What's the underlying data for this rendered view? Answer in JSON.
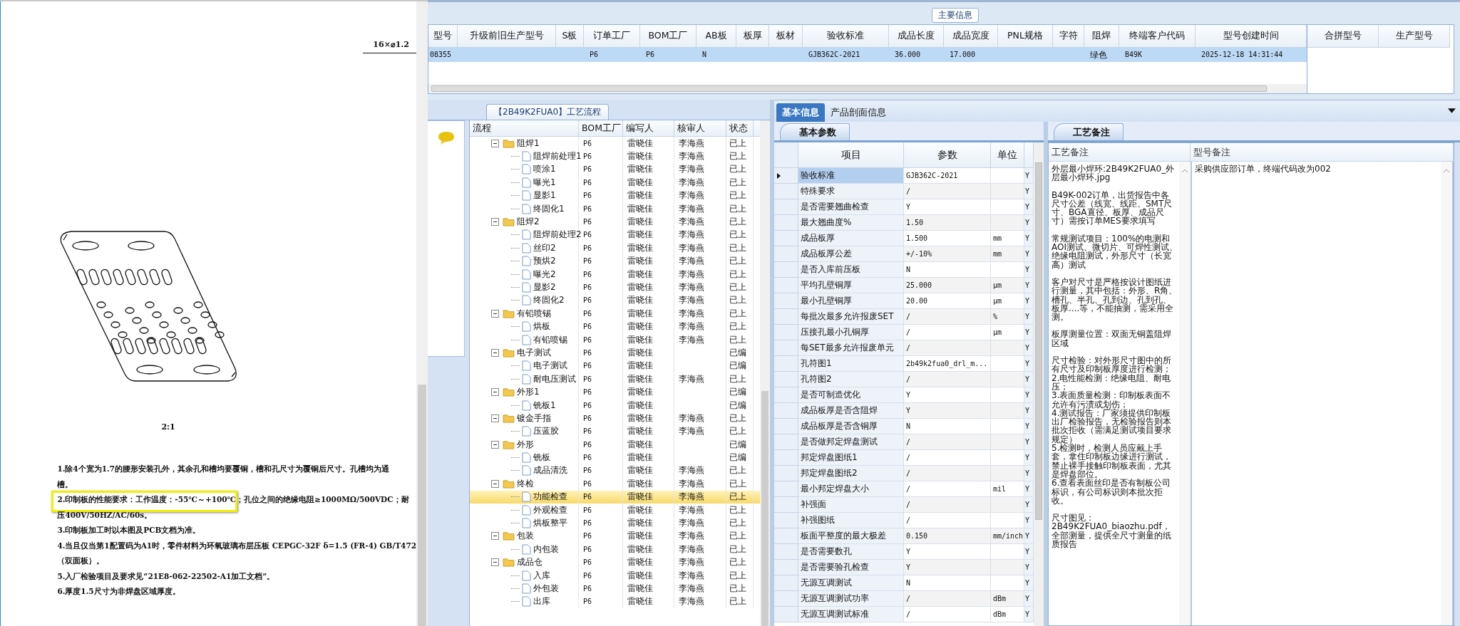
{
  "document": {
    "dimension": "16×⌀1.2",
    "scale": "2:1",
    "notes": [
      "1.除4个宽为1.7的腰形安装孔外，其余孔和槽均要覆铜，槽和孔尺寸为覆铜后尺寸。孔槽均为通",
      "槽。",
      "2.印制板的性能要求：工作温度：-55℃～+100℃；孔位之间的绝缘电阻≥1000MΩ/500VDC；耐",
      "压400V/50HZ/AC/60s。",
      "3.印制板加工时以本图及PCB文档为准。",
      "4.当且仅当第1配置码为A1时，零件材料为环氧玻璃布层压板 CEPGC-32F δ=1.5 (FR-4) GB/T472",
      "（双面板）。",
      "5.入厂检验项目及要求见“21E8-062-22502-A1加工文档”。",
      "6.厚度1.5尺寸为非焊盘区域厚度。"
    ]
  },
  "main_info": {
    "title": "主要信息",
    "columns": [
      "型号",
      "升级前旧生产型号",
      "S板",
      "订单工厂",
      "BOM工厂",
      "AB板",
      "板厚",
      "板材",
      "验收标准",
      "成品长度",
      "成品宽度",
      "PNL规格",
      "字符",
      "阻焊",
      "终端客户代码",
      "型号创建时间"
    ],
    "rows": [
      {
        "selected": true,
        "cells": [
          "08355",
          "",
          "",
          "P6",
          "P6",
          "N",
          "",
          "",
          "GJB362C-2021",
          "36.000",
          "17.000",
          "",
          "",
          "绿色",
          "B49K",
          "2025-12-18 14:31:44"
        ]
      }
    ],
    "side_columns": [
      "合拼型号",
      "生产型号"
    ]
  },
  "process": {
    "title": "【2B49K2FUA0】工艺流程",
    "columns": [
      "流程",
      "BOM工厂",
      "编写人",
      "核审人",
      "状态"
    ],
    "tree": [
      {
        "name": "阻焊1",
        "bom": "P6",
        "author": "雷晓佳",
        "reviewer": "李海燕",
        "status": "已上",
        "selected": false,
        "expanded": true,
        "children": [
          {
            "name": "阻焊前处理1",
            "bom": "P6",
            "author": "雷晓佳",
            "reviewer": "李海燕",
            "status": "已上",
            "selected": false
          },
          {
            "name": "喷涂1",
            "bom": "P6",
            "author": "雷晓佳",
            "reviewer": "李海燕",
            "status": "已上",
            "selected": false
          },
          {
            "name": "曝光1",
            "bom": "P6",
            "author": "雷晓佳",
            "reviewer": "李海燕",
            "status": "已上",
            "selected": false
          },
          {
            "name": "显影1",
            "bom": "P6",
            "author": "雷晓佳",
            "reviewer": "李海燕",
            "status": "已上",
            "selected": false
          },
          {
            "name": "终固化1",
            "bom": "P6",
            "author": "雷晓佳",
            "reviewer": "李海燕",
            "status": "已上",
            "selected": false
          }
        ]
      },
      {
        "name": "阻焊2",
        "bom": "P6",
        "author": "雷晓佳",
        "reviewer": "李海燕",
        "status": "已上",
        "selected": false,
        "expanded": true,
        "children": [
          {
            "name": "阻焊前处理2",
            "bom": "P6",
            "author": "雷晓佳",
            "reviewer": "李海燕",
            "status": "已上",
            "selected": false
          },
          {
            "name": "丝印2",
            "bom": "P6",
            "author": "雷晓佳",
            "reviewer": "李海燕",
            "status": "已上",
            "selected": false
          },
          {
            "name": "预烘2",
            "bom": "P6",
            "author": "雷晓佳",
            "reviewer": "李海燕",
            "status": "已上",
            "selected": false
          },
          {
            "name": "曝光2",
            "bom": "P6",
            "author": "雷晓佳",
            "reviewer": "李海燕",
            "status": "已上",
            "selected": false
          },
          {
            "name": "显影2",
            "bom": "P6",
            "author": "雷晓佳",
            "reviewer": "李海燕",
            "status": "已上",
            "selected": false
          },
          {
            "name": "终固化2",
            "bom": "P6",
            "author": "雷晓佳",
            "reviewer": "李海燕",
            "status": "已上",
            "selected": false
          }
        ]
      },
      {
        "name": "有铅喷锡",
        "bom": "P6",
        "author": "雷晓佳",
        "reviewer": "李海燕",
        "status": "已上",
        "selected": false,
        "expanded": true,
        "children": [
          {
            "name": "烘板",
            "bom": "P6",
            "author": "雷晓佳",
            "reviewer": "李海燕",
            "status": "已上",
            "selected": false
          },
          {
            "name": "有铅喷锡",
            "bom": "P6",
            "author": "雷晓佳",
            "reviewer": "李海燕",
            "status": "已上",
            "selected": false
          }
        ]
      },
      {
        "name": "电子测试",
        "bom": "P6",
        "author": "雷晓佳",
        "status": "已编",
        "selected": false,
        "expanded": true,
        "children": [
          {
            "name": "电子测试",
            "bom": "P6",
            "author": "雷晓佳",
            "status": "已编",
            "selected": false
          },
          {
            "name": "耐电压测试",
            "bom": "P6",
            "author": "雷晓佳",
            "reviewer": "李海燕",
            "status": "已上",
            "selected": false
          }
        ]
      },
      {
        "name": "外形1",
        "bom": "P6",
        "author": "雷晓佳",
        "status": "已编",
        "selected": false,
        "expanded": true,
        "children": [
          {
            "name": "铣板1",
            "bom": "P6",
            "author": "雷晓佳",
            "status": "已编",
            "selected": false
          }
        ]
      },
      {
        "name": "镀金手指",
        "bom": "P6",
        "author": "雷晓佳",
        "reviewer": "李海燕",
        "status": "已上",
        "selected": false,
        "expanded": true,
        "children": [
          {
            "name": "压蓝胶",
            "bom": "P6",
            "author": "雷晓佳",
            "reviewer": "李海燕",
            "status": "已上",
            "selected": false
          }
        ]
      },
      {
        "name": "外形",
        "bom": "P6",
        "author": "雷晓佳",
        "status": "已编",
        "selected": false,
        "expanded": true,
        "children": [
          {
            "name": "铣板",
            "bom": "P6",
            "author": "雷晓佳",
            "status": "已编",
            "selected": false
          },
          {
            "name": "成品清洗",
            "bom": "P6",
            "author": "雷晓佳",
            "reviewer": "李海燕",
            "status": "已上",
            "selected": false
          }
        ]
      },
      {
        "name": "终检",
        "bom": "P6",
        "author": "雷晓佳",
        "reviewer": "李海燕",
        "status": "已上",
        "selected": false,
        "expanded": true,
        "children": [
          {
            "name": "功能检查",
            "bom": "P6",
            "author": "雷晓佳",
            "reviewer": "李海燕",
            "status": "已上",
            "selected": true
          },
          {
            "name": "外观检查",
            "bom": "P6",
            "author": "雷晓佳",
            "reviewer": "李海燕",
            "status": "已上",
            "selected": false
          },
          {
            "name": "烘板整平",
            "bom": "P6",
            "author": "雷晓佳",
            "reviewer": "李海燕",
            "status": "已上",
            "selected": false
          }
        ]
      },
      {
        "name": "包装",
        "bom": "P6",
        "author": "雷晓佳",
        "reviewer": "李海燕",
        "status": "已上",
        "selected": false,
        "expanded": true,
        "children": [
          {
            "name": "内包装",
            "bom": "P6",
            "author": "雷晓佳",
            "reviewer": "李海燕",
            "status": "已上",
            "selected": false
          }
        ]
      },
      {
        "name": "成品仓",
        "bom": "P6",
        "author": "雷晓佳",
        "reviewer": "李海燕",
        "status": "已上",
        "selected": false,
        "expanded": true,
        "children": [
          {
            "name": "入库",
            "bom": "P6",
            "author": "雷晓佳",
            "reviewer": "李海燕",
            "status": "已上",
            "selected": false
          },
          {
            "name": "外包装",
            "bom": "P6",
            "author": "雷晓佳",
            "reviewer": "李海燕",
            "status": "已上",
            "selected": false
          },
          {
            "name": "出库",
            "bom": "P6",
            "author": "雷晓佳",
            "reviewer": "李海燕",
            "status": "已上",
            "selected": false
          }
        ]
      }
    ]
  },
  "basic": {
    "tabs": [
      {
        "label": "基本信息",
        "selected": true
      },
      {
        "label": "产品剖面信息",
        "selected": false
      }
    ],
    "subtab": "基本参数",
    "columns": [
      "项目",
      "参数",
      "单位"
    ],
    "rows": [
      {
        "item": "验收标准",
        "value": "GJB362C-2021",
        "column_4": "Y",
        "selected": true
      },
      {
        "item": "特殊要求",
        "value": "/",
        "column_4": "Y",
        "selected": false
      },
      {
        "item": "是否需要翘曲检查",
        "value": "Y",
        "column_4": "Y",
        "selected": false
      },
      {
        "item": "最大翘曲度%",
        "value": "1.50",
        "column_4": "Y",
        "selected": false
      },
      {
        "item": "成品板厚",
        "value": "1.500",
        "unit": "mm",
        "column_4": "Y",
        "selected": false
      },
      {
        "item": "成品板厚公差",
        "value": "+/-10%",
        "unit": "mm",
        "column_4": "Y",
        "selected": false
      },
      {
        "item": "是否入库前压板",
        "value": "N",
        "column_4": "Y",
        "selected": false
      },
      {
        "item": "平均孔壁铜厚",
        "value": "25.000",
        "unit": "μm",
        "column_4": "Y",
        "selected": false
      },
      {
        "item": "最小孔壁铜厚",
        "value": "20.00",
        "unit": "μm",
        "column_4": "Y",
        "selected": false
      },
      {
        "item": "每批次最多允许报废SET",
        "value": "/",
        "unit": "%",
        "column_4": "Y",
        "selected": false
      },
      {
        "item": "压接孔最小孔铜厚",
        "value": "/",
        "unit": "μm",
        "column_4": "Y",
        "selected": false
      },
      {
        "item": "每SET最多允许报废单元",
        "value": "/",
        "column_4": "Y",
        "selected": false
      },
      {
        "item": "孔符图1",
        "value": "2b49k2fua0_drl_m...",
        "column_4": "Y",
        "selected": false
      },
      {
        "item": "孔符图2",
        "value": "/",
        "column_4": "Y",
        "selected": false
      },
      {
        "item": "是否可制造优化",
        "value": "Y",
        "column_4": "Y",
        "selected": false
      },
      {
        "item": "成品板厚是否含阻焊",
        "value": "Y",
        "column_4": "Y",
        "selected": false
      },
      {
        "item": "成品板厚是否含铜厚",
        "value": "N",
        "column_4": "Y",
        "selected": false
      },
      {
        "item": "是否做邦定焊盘测试",
        "value": "/",
        "column_4": "Y",
        "selected": false
      },
      {
        "item": "邦定焊盘图纸1",
        "value": "/",
        "column_4": "Y",
        "selected": false
      },
      {
        "item": "邦定焊盘图纸2",
        "value": "/",
        "column_4": "Y",
        "selected": false
      },
      {
        "item": "最小邦定焊盘大小",
        "value": "/",
        "unit": "mil",
        "column_4": "Y",
        "selected": false
      },
      {
        "item": "补强面",
        "value": "/",
        "column_4": "Y",
        "selected": false
      },
      {
        "item": "补强图纸",
        "value": "/",
        "column_4": "Y",
        "selected": false
      },
      {
        "item": "板面平整度的最大极差",
        "value": "0.150",
        "unit": "mm/inch",
        "column_4": "Y",
        "selected": false
      },
      {
        "item": "是否需要数孔",
        "value": "Y",
        "column_4": "Y",
        "selected": false
      },
      {
        "item": "是否需要验孔检查",
        "value": "Y",
        "column_4": "Y",
        "selected": false
      },
      {
        "item": "无源互调测试",
        "value": "N",
        "column_4": "Y",
        "selected": false
      },
      {
        "item": "无源互调测试功率",
        "value": "/",
        "unit": "dBm",
        "column_4": "Y",
        "selected": false
      },
      {
        "item": "无源互调测试标准",
        "value": "/",
        "unit": "dBm",
        "column_4": "Y",
        "selected": false
      }
    ]
  },
  "notes": {
    "subtab": "工艺备注",
    "columns": [
      "工艺备注",
      "型号备注"
    ],
    "process_notes": [
      [
        "外层最小焊环:2B49K2FUA0_外层最小焊环.jpg"
      ],
      [
        "B49K-002订单，出货报告中各尺寸公差（线宽、线距、SMT尺寸、BGA直径、板厚、成品尺寸）需按订单MES要求填写"
      ],
      [
        "常规测试项目：100%的电测和AOI测试、微切片、可焊性测试、绝缘电阻测试，外形尺寸（长宽高）测试"
      ],
      [
        "客户对尺寸是严格按设计图纸进行测量，其中包括：外形、R角、槽孔、半孔、孔到边、孔到孔、板厚....等，不能抽测，需采用全测。"
      ],
      [
        "板厚测量位置：双面无铜盖阻焊区域"
      ],
      [
        "尺寸检验：对外形尺寸图中的所有尺寸及印制板厚度进行检测；",
        "2.电性能检测：绝缘电阻、耐电压；",
        "3.表面质量检测：印制板表面不允许有污渍或划伤；",
        "4.测试报告：厂家须提供印制板出厂检验报告，无检验报告则本批次拒收（需满足测试项目要求规定）",
        "5.检测时，检测人员应戴上手套，拿住印制板边缘进行测试，禁止裸手接触印制板表面，尤其是焊盘部位。",
        "6.查看表面丝印是否有制板公司标识，有公司标识则本批次拒收。"
      ],
      [
        "尺寸图见：2B49K2FUA0_biaozhu.pdf，全部测量，提供全尺寸测量的纸质报告"
      ]
    ],
    "model_notes": "采购供应部订单，终端代码改为002"
  }
}
